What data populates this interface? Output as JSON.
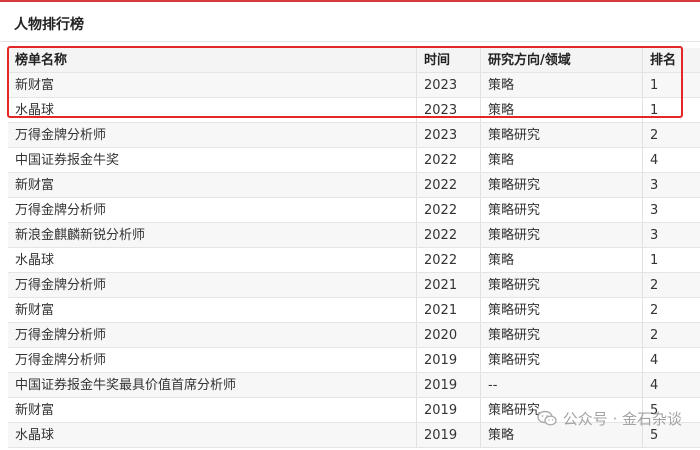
{
  "section": {
    "title": "人物排行榜"
  },
  "table": {
    "headers": [
      "榜单名称",
      "时间",
      "研究方向/领域",
      "排名"
    ],
    "rows": [
      [
        "新财富",
        "2023",
        "策略",
        "1"
      ],
      [
        "水晶球",
        "2023",
        "策略",
        "1"
      ],
      [
        "万得金牌分析师",
        "2023",
        "策略研究",
        "2"
      ],
      [
        "中国证券报金牛奖",
        "2022",
        "策略",
        "4"
      ],
      [
        "新财富",
        "2022",
        "策略研究",
        "3"
      ],
      [
        "万得金牌分析师",
        "2022",
        "策略研究",
        "3"
      ],
      [
        "新浪金麒麟新锐分析师",
        "2022",
        "策略研究",
        "3"
      ],
      [
        "水晶球",
        "2022",
        "策略",
        "1"
      ],
      [
        "万得金牌分析师",
        "2021",
        "策略研究",
        "2"
      ],
      [
        "新财富",
        "2021",
        "策略研究",
        "2"
      ],
      [
        "万得金牌分析师",
        "2020",
        "策略研究",
        "2"
      ],
      [
        "万得金牌分析师",
        "2019",
        "策略研究",
        "4"
      ],
      [
        "中国证券报金牛奖最具价值首席分析师",
        "2019",
        "--",
        "4"
      ],
      [
        "新财富",
        "2019",
        "策略研究",
        "5"
      ],
      [
        "水晶球",
        "2019",
        "策略",
        "5"
      ]
    ]
  },
  "watermark": {
    "text": "公众号 · 金石杂谈",
    "icon": "wechat-icon"
  },
  "colors": {
    "highlight": "#e32626",
    "accent_border": "#d63b3b"
  }
}
